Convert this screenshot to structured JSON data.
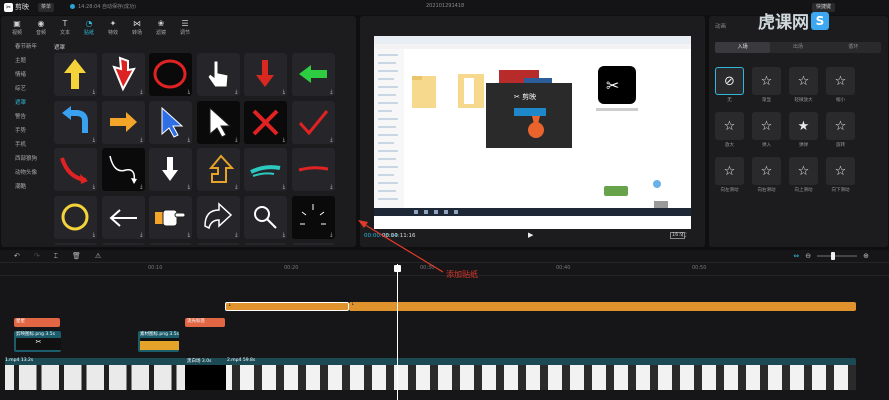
{
  "app": {
    "title": "剪映",
    "menu_label": "菜单",
    "autosave": "14:28:04 自动保存(成功)",
    "project": "202101291418",
    "shortcut_label": "快捷键"
  },
  "toolbar": [
    {
      "label": "视频",
      "icon": "media-icon"
    },
    {
      "label": "音频",
      "icon": "audio-icon"
    },
    {
      "label": "文本",
      "icon": "text-icon"
    },
    {
      "label": "贴纸",
      "icon": "sticker-icon",
      "active": true
    },
    {
      "label": "特效",
      "icon": "effects-icon"
    },
    {
      "label": "转场",
      "icon": "transition-icon"
    },
    {
      "label": "滤镜",
      "icon": "filter-icon"
    },
    {
      "label": "调节",
      "icon": "adjust-icon"
    }
  ],
  "categories": [
    "春节新年",
    "主题",
    "情绪",
    "综艺",
    "遮罩",
    "警告",
    "手势",
    "手机",
    "西部狼狗",
    "动物头像",
    "潮酷"
  ],
  "active_category": "遮罩",
  "grid_title": "遮罩",
  "player": {
    "time_current": "00:00:08:14",
    "time_total": "00:00:11:16",
    "ratio": "16:9"
  },
  "right_panel": {
    "title": "动画",
    "tabs": [
      "入场",
      "出场",
      "循环"
    ],
    "active_tab": "入场",
    "anims": [
      {
        "label": "无",
        "glyph": "⊘",
        "selected": true
      },
      {
        "label": "渐显",
        "glyph": "☆"
      },
      {
        "label": "轻微放大",
        "glyph": "☆"
      },
      {
        "label": "缩小",
        "glyph": "☆"
      },
      {
        "label": "放大",
        "glyph": "☆"
      },
      {
        "label": "弹入",
        "glyph": "☆"
      },
      {
        "label": "弹弹",
        "glyph": "★"
      },
      {
        "label": "旋转",
        "glyph": "☆"
      },
      {
        "label": "向左滑动",
        "glyph": "☆"
      },
      {
        "label": "向右滑动",
        "glyph": "☆"
      },
      {
        "label": "向上滑动",
        "glyph": "☆"
      },
      {
        "label": "向下滑动",
        "glyph": "☆"
      }
    ]
  },
  "watermark": {
    "text": "虎课网",
    "icon_letter": "S"
  },
  "timeline": {
    "ticks": [
      {
        "label": "00:10"
      },
      {
        "label": "00:20"
      },
      {
        "label": "00:30"
      },
      {
        "label": "00:40"
      },
      {
        "label": "00:50"
      }
    ],
    "clips": {
      "red1": "星星",
      "red2": "流光标签",
      "img1": "剪映图标.png 3.5s",
      "img2": "素材图标.png 3.5s",
      "v1": "1.mp4 13.2s",
      "v2": "黑白场 3.0s",
      "v3": "2.mp4 59.8s"
    }
  },
  "annotation": "添加贴纸",
  "colors": {
    "accent": "#2fb8d9",
    "annotation": "#e23a2a",
    "track_orange": "#e0932d",
    "track_red": "#e06644",
    "track_teal": "#1b5d6b"
  }
}
